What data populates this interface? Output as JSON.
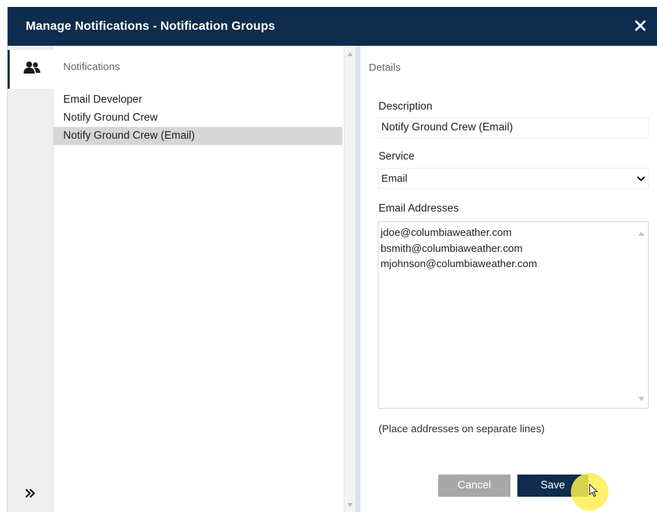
{
  "dialog": {
    "title": "Manage Notifications - Notification Groups",
    "close_icon": "close-icon"
  },
  "leftrail": {
    "tab_icon": "users-icon",
    "expand_icon": "double-chevron-right-icon",
    "expand_glyph": "»"
  },
  "notifications": {
    "heading": "Notifications",
    "items": [
      {
        "label": "Email Developer",
        "selected": false
      },
      {
        "label": "Notify Ground Crew",
        "selected": false
      },
      {
        "label": "Notify Ground Crew (Email)",
        "selected": true
      }
    ]
  },
  "details": {
    "heading": "Details",
    "description_label": "Description",
    "description_value": "Notify Ground Crew (Email)",
    "service_label": "Service",
    "service_value": "Email",
    "email_label": "Email Addresses",
    "email_addresses": [
      "jdoe@columbiaweather.com",
      "bsmith@columbiaweather.com",
      "mjohnson@columbiaweather.com"
    ],
    "hint": "(Place addresses on separate lines)",
    "cancel_label": "Cancel",
    "save_label": "Save"
  },
  "colors": {
    "titlebar": "#0d2c4e",
    "selected_row": "#d6d6d6",
    "cancel_button": "#a8a8a8",
    "save_button": "#0d2c4e"
  }
}
